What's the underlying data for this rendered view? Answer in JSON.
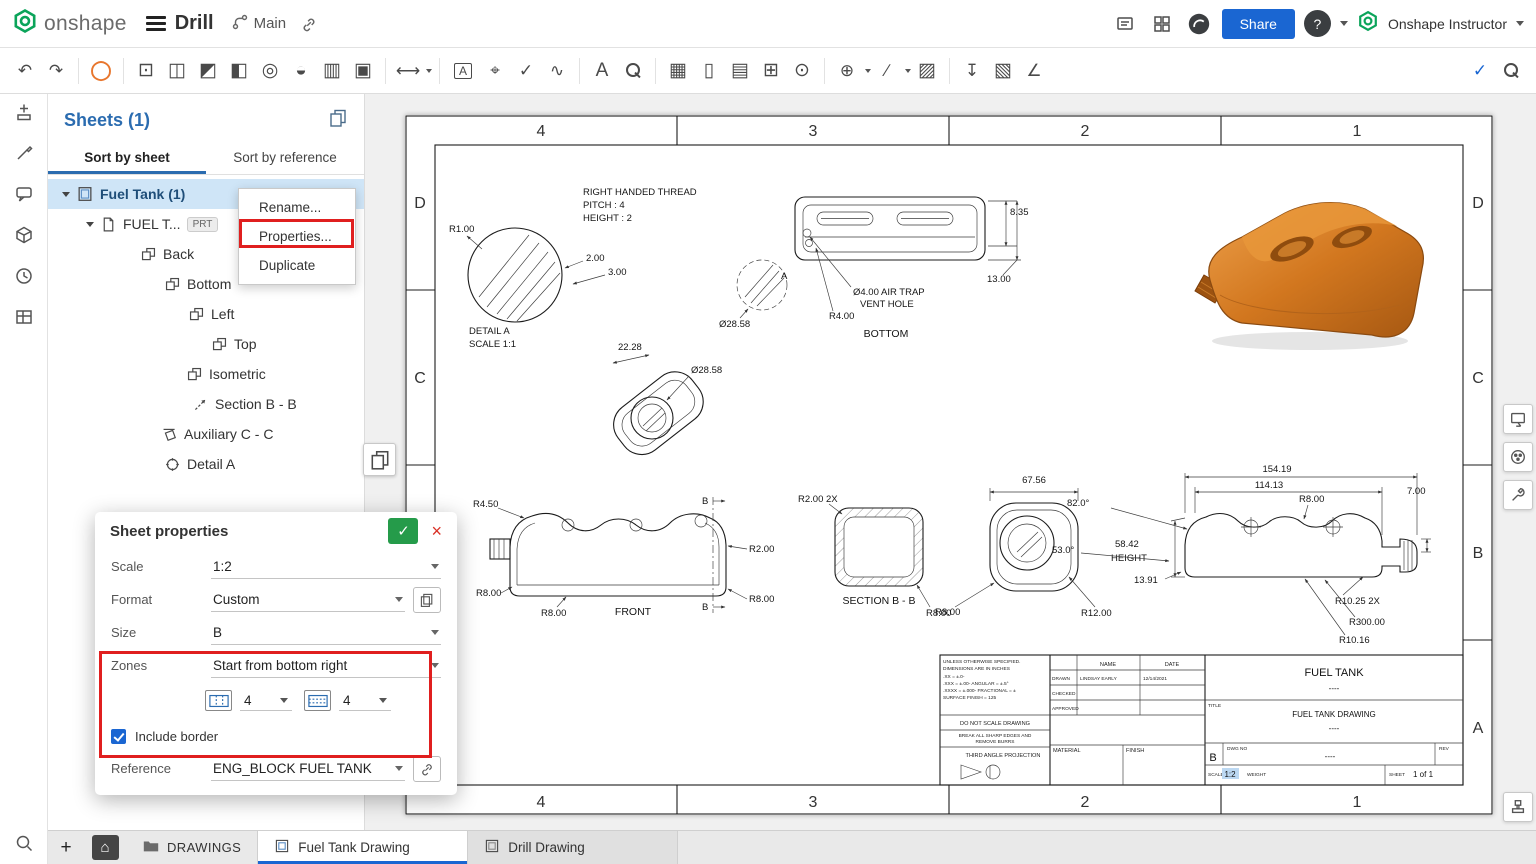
{
  "ui": {
    "plus": "+",
    "home": "⌂",
    "check": "✓",
    "close": "×"
  },
  "topbar": {
    "brand": "onshape",
    "document_title": "Drill",
    "branch_name": "Main",
    "share_label": "Share",
    "help_glyph": "?",
    "user_name": "Onshape Instructor"
  },
  "toolbar": {
    "icons": {
      "undo": "↶",
      "redo": "↷",
      "sketch": "◯",
      "insert_view": "⊡",
      "projected_view": "◫",
      "auxiliary_view": "◩",
      "partial_view": "◧",
      "detail_view": "◎",
      "section_view": "◒",
      "break_view": "▥",
      "crop_view": "▣",
      "dimension": "⟷",
      "note": "A",
      "datum": "⌖",
      "surface_finish": "✓",
      "weld": "∿",
      "text": "A",
      "table": "▦",
      "sheet_list": "▯",
      "bom": "▤",
      "hole_table": "⊞",
      "balloon": "⊙",
      "centerline": "⊕",
      "line_style": "∕",
      "hatch": "▨",
      "export_dxf": "↧",
      "image": "▧",
      "measure": "∠",
      "check": "✓"
    }
  },
  "left_panel_icons": [
    "sheets-icon",
    "insert-icon",
    "style-icon",
    "comment-icon",
    "parts-icon",
    "history-icon",
    "tables-icon",
    "search-icon"
  ],
  "right_tool_icons": [
    "view-options-icon",
    "appearance-icon",
    "tools-icon",
    "stamp-icon"
  ],
  "sheets_panel": {
    "title": "Sheets (1)",
    "tab_sort_by_sheet": "Sort by sheet",
    "tab_sort_by_reference": "Sort by reference",
    "sheet_item": "Fuel Tank (1)",
    "reference_item": "FUEL T...",
    "reference_badge": "PRT",
    "views": [
      {
        "label": "Back"
      },
      {
        "label": "Bottom"
      },
      {
        "label": "Left"
      },
      {
        "label": "Top"
      },
      {
        "label": "Isometric"
      },
      {
        "label": "Section B - B"
      },
      {
        "label": "Auxiliary C - C"
      },
      {
        "label": "Detail A"
      }
    ]
  },
  "context_menu": {
    "rename": "Rename...",
    "properties": "Properties...",
    "duplicate": "Duplicate"
  },
  "dialog": {
    "title": "Sheet properties",
    "scale_label": "Scale",
    "scale_value": "1:2",
    "format_label": "Format",
    "format_value": "Custom",
    "size_label": "Size",
    "size_value": "B",
    "zones_label": "Zones",
    "zones_value": "Start from bottom right",
    "zone_cols": "4",
    "zone_rows": "4",
    "include_border_label": "Include border",
    "reference_label": "Reference",
    "reference_value": "ENG_BLOCK FUEL TANK"
  },
  "bottom_bar": {
    "folder_label": "DRAWINGS",
    "active_tab": "Fuel Tank Drawing",
    "inactive_tab": "Drill Drawing"
  },
  "drawing": {
    "zones": [
      "4",
      "3",
      "2",
      "1"
    ],
    "zone_letters": [
      "D",
      "C",
      "B",
      "A"
    ],
    "detail_view": {
      "note1": "RIGHT HANDED THREAD",
      "note2": "PITCH : 4",
      "note3": "HEIGHT : 2",
      "r1": "R1.00",
      "d2": "2.00",
      "d3": "3.00",
      "title": "DETAIL A",
      "scale": "SCALE 1:1"
    },
    "bottom_view": {
      "d835": "8.35",
      "d1300": "13.00",
      "airtrap1": "Ø4.00 AIR TRAP",
      "airtrap2": "VENT HOLE",
      "r400": "R4.00",
      "dia2858": "Ø28.58",
      "callout": "A",
      "title": "BOTTOM"
    },
    "aux_view": {
      "d2228": "22.28",
      "dia2858": "Ø28.58"
    },
    "front_view": {
      "r450": "R4.50",
      "b1": "B",
      "r200": "R2.00",
      "b2": "B",
      "r800a": "R8.00",
      "r800b": "R8.00",
      "r800c": "R8.00",
      "title": "FRONT"
    },
    "section_view": {
      "r200": "R2.00 2X",
      "title": "SECTION B - B",
      "r800": "R8.00"
    },
    "side_view": {
      "d6756": "67.56",
      "r800": "R8.00",
      "r1200": "R12.00"
    },
    "right_view": {
      "d15419": "154.19",
      "d11413": "114.13",
      "a820": "82.0°",
      "r800": "R8.00",
      "d700": "7.00",
      "d5842": "58.42",
      "height": "HEIGHT",
      "a530": "53.0°",
      "d1391": "13.91",
      "r1025": "R10.25 2X",
      "r30000": "R300.00",
      "r1016": "R10.16"
    },
    "title_block": {
      "tol1": "UNLESS OTHERWISE SPECIFIED.",
      "tol2": "DIMENSIONS ARE IN INCHES",
      "tol3": ".XX = ±.0-",
      "tol4": ".XXX = ±.00-      ANGULAR = ±.5°",
      "tol5": ".XXXX = ±.000-   FRACTIONAL = ±",
      "tol6": "SURFACE FINISH = 125",
      "name_h": "NAME",
      "date_h": "DATE",
      "drawn_label": "DRAWN",
      "drawn_name": "LINDSAY EARLY",
      "drawn_date": "12/14/2021",
      "checked_label": "CHECKED",
      "approved_label": "APPROVED",
      "no_scale": "DO NOT SCALE DRAWING",
      "deburr1": "BREAK ALL SHARP EDGES AND",
      "deburr2": "REMOVE BURRS",
      "projection": "THIRD ANGLE PROJECTION",
      "material_label": "MATERIAL",
      "finish_label": "FINISH",
      "company": "FUEL TANK",
      "title_label": "TITLE",
      "title": "FUEL TANK DRAWING",
      "sub1": "----",
      "sub2": "----",
      "sub3": "----",
      "size": "B",
      "dwg_label": "DWG NO",
      "rev_label": "REV",
      "scale_label": "SCALE",
      "scale_value": "1:2",
      "weight_label": "WEIGHT",
      "sheet_label": "SHEET",
      "sheet_value": "1 of 1"
    }
  }
}
